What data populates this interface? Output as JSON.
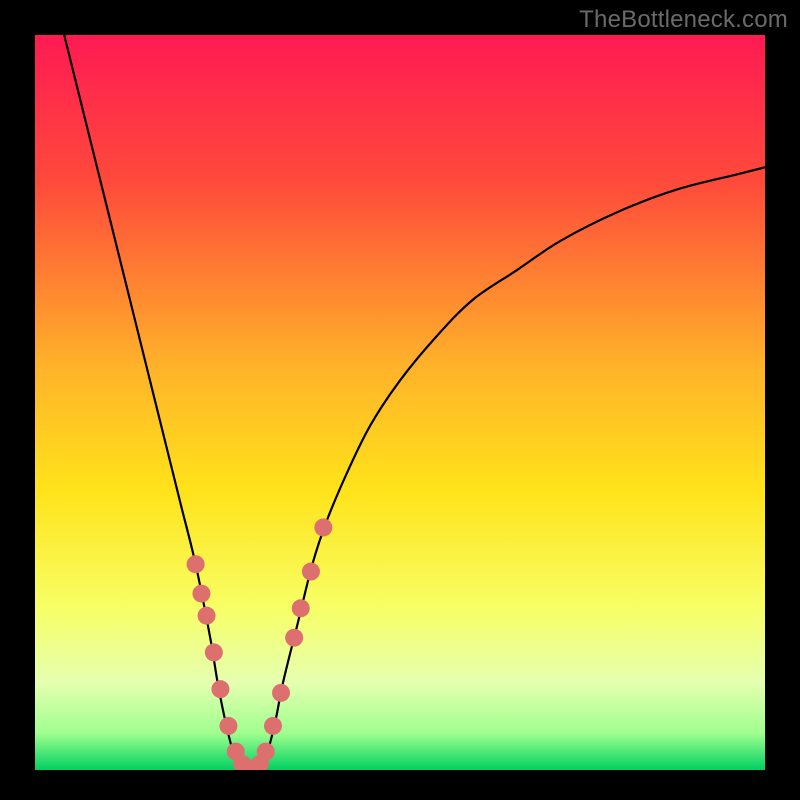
{
  "watermark": "TheBottleneck.com",
  "chart_data": {
    "type": "line",
    "title": "",
    "xlabel": "",
    "ylabel": "",
    "xlim": [
      0,
      100
    ],
    "ylim": [
      0,
      100
    ],
    "grid": false,
    "legend": false,
    "background": {
      "type": "vertical-gradient",
      "stops": [
        {
          "pos": 0.0,
          "color": "#ff1a53"
        },
        {
          "pos": 0.2,
          "color": "#ff4a3b"
        },
        {
          "pos": 0.45,
          "color": "#ffb22a"
        },
        {
          "pos": 0.62,
          "color": "#ffe31a"
        },
        {
          "pos": 0.78,
          "color": "#f7ff66"
        },
        {
          "pos": 0.88,
          "color": "#e6ffb0"
        },
        {
          "pos": 0.95,
          "color": "#9fff8f"
        },
        {
          "pos": 1.0,
          "color": "#00d061"
        }
      ]
    },
    "series": [
      {
        "name": "bottleneck-curve",
        "stroke": "#000000",
        "stroke_width": 2.2,
        "x": [
          4,
          6,
          8,
          10,
          12,
          14,
          16,
          18,
          20,
          22,
          24,
          25,
          26,
          27,
          28,
          29,
          30,
          31,
          32,
          33,
          34,
          36,
          38,
          40,
          43,
          46,
          50,
          55,
          60,
          66,
          72,
          80,
          88,
          96,
          100
        ],
        "y": [
          100,
          92,
          84,
          76,
          68,
          60,
          52,
          44,
          36,
          28,
          18,
          12,
          7,
          3,
          1,
          0,
          0,
          1,
          3,
          7,
          12,
          20,
          28,
          34,
          41,
          47,
          53,
          59,
          64,
          68,
          72,
          76,
          79,
          81,
          82
        ]
      }
    ],
    "markers": {
      "name": "highlight-dots",
      "color": "#de6f6f",
      "radius": 9,
      "points": [
        {
          "x": 22.0,
          "y": 28.0
        },
        {
          "x": 22.8,
          "y": 24.0
        },
        {
          "x": 23.5,
          "y": 21.0
        },
        {
          "x": 24.5,
          "y": 16.0
        },
        {
          "x": 25.4,
          "y": 11.0
        },
        {
          "x": 26.5,
          "y": 6.0
        },
        {
          "x": 27.5,
          "y": 2.5
        },
        {
          "x": 28.4,
          "y": 0.8
        },
        {
          "x": 29.2,
          "y": 0.2
        },
        {
          "x": 30.0,
          "y": 0.2
        },
        {
          "x": 30.8,
          "y": 0.8
        },
        {
          "x": 31.6,
          "y": 2.5
        },
        {
          "x": 32.6,
          "y": 6.0
        },
        {
          "x": 33.7,
          "y": 10.5
        },
        {
          "x": 35.5,
          "y": 18.0
        },
        {
          "x": 36.4,
          "y": 22.0
        },
        {
          "x": 37.8,
          "y": 27.0
        },
        {
          "x": 39.5,
          "y": 33.0
        }
      ]
    }
  }
}
